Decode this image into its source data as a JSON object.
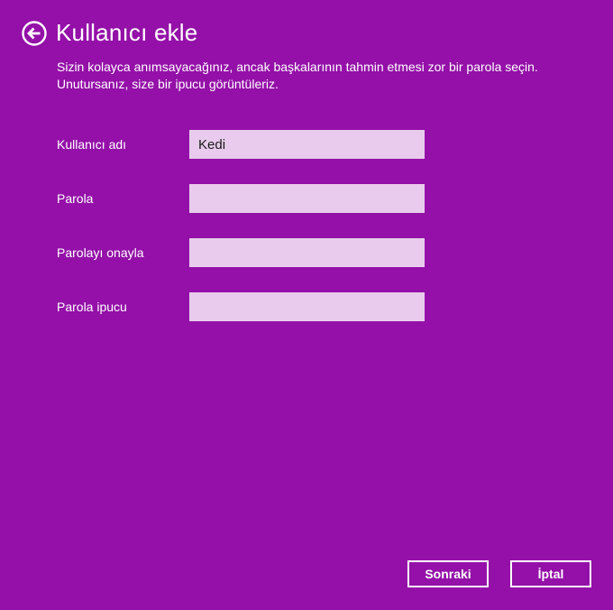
{
  "header": {
    "back_icon": "arrow-left-circle-icon",
    "title": "Kullanıcı ekle"
  },
  "description": {
    "line1": "Sizin kolayca anımsayacağınız, ancak başkalarının tahmin etmesi zor bir parola seçin.",
    "line2": "Unutursanız, size bir ipucu görüntüleriz."
  },
  "form": {
    "username": {
      "label": "Kullanıcı adı",
      "value": "Kedi"
    },
    "password": {
      "label": "Parola",
      "value": ""
    },
    "confirm_password": {
      "label": "Parolayı onayla",
      "value": ""
    },
    "password_hint": {
      "label": "Parola ipucu",
      "value": ""
    }
  },
  "buttons": {
    "next_label": "Sonraki",
    "cancel_label": "İptal"
  },
  "colors": {
    "background": "#9410a8",
    "field_background": "#e9cced",
    "text": "#ffffff"
  }
}
